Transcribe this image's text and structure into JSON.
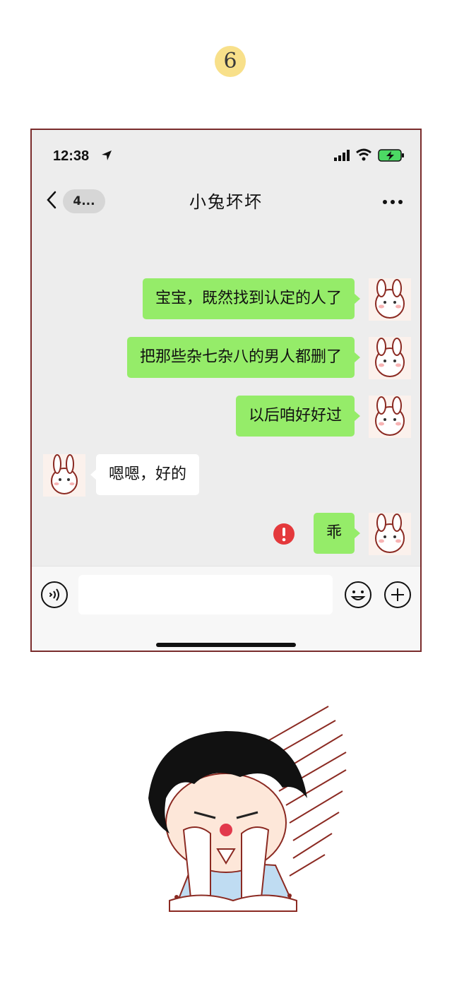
{
  "page_number": "6",
  "status_bar": {
    "time": "12:38",
    "icons": [
      "location-arrow-icon",
      "cellular-signal-icon",
      "wifi-icon",
      "battery-charging-icon"
    ]
  },
  "nav": {
    "back_icon": "chevron-left-icon",
    "unread_badge": "4...",
    "title": "小兔坏坏",
    "more_icon": "more-dots-icon"
  },
  "messages": [
    {
      "side": "out",
      "text": "宝宝，既然找到认定的人了"
    },
    {
      "side": "out",
      "text": "把那些杂七杂八的男人都删了"
    },
    {
      "side": "out",
      "text": "以后咱好好过"
    },
    {
      "side": "in",
      "text": "嗯嗯，好的"
    },
    {
      "side": "out",
      "text": "乖",
      "status": "send-failed"
    }
  ],
  "input_bar": {
    "text_value": "",
    "icons": [
      "voice-icon",
      "emoji-icon",
      "plus-icon"
    ]
  },
  "colors": {
    "outgoing_bubble": "#95ec69",
    "incoming_bubble": "#ffffff",
    "chat_background": "#ededed",
    "error_badge": "#e4393c",
    "page_number_badge": "#f8e08a",
    "frame_border": "#7a2c2c"
  },
  "illustration": "crying-boy-cartoon"
}
